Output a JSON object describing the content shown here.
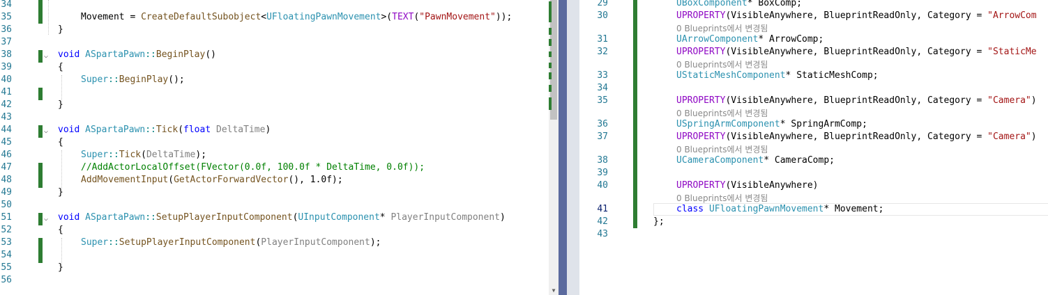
{
  "left_editor": {
    "lines": [
      {
        "n": "34"
      },
      {
        "n": "35",
        "tokens": [
          [
            "Movement = ",
            ""
          ],
          [
            "CreateDefaultSubobject",
            "fn"
          ],
          [
            "<",
            ""
          ],
          [
            "UFloatingPawnMovement",
            "ty"
          ],
          [
            ">(",
            ""
          ],
          [
            "TEXT",
            "mc"
          ],
          [
            "(",
            ""
          ],
          [
            "\"PawnMovement\"",
            "st"
          ],
          [
            "));",
            ""
          ]
        ]
      },
      {
        "n": "36",
        "tokens": [
          [
            "}",
            ""
          ]
        ]
      },
      {
        "n": "37"
      },
      {
        "n": "38",
        "tokens": [
          [
            "void",
            "kw"
          ],
          [
            " ",
            ""
          ],
          [
            "ASpartaPawn",
            "ty"
          ],
          [
            "::",
            "op"
          ],
          [
            "BeginPlay",
            "fn"
          ],
          [
            "()",
            ""
          ]
        ]
      },
      {
        "n": "39",
        "tokens": [
          [
            "{",
            ""
          ]
        ]
      },
      {
        "n": "40",
        "tokens": [
          [
            "Super",
            "ty"
          ],
          [
            "::",
            "op"
          ],
          [
            "BeginPlay",
            "fn"
          ],
          [
            "();",
            ""
          ]
        ]
      },
      {
        "n": "41"
      },
      {
        "n": "42",
        "tokens": [
          [
            "}",
            ""
          ]
        ]
      },
      {
        "n": "43"
      },
      {
        "n": "44",
        "tokens": [
          [
            "void",
            "kw"
          ],
          [
            " ",
            ""
          ],
          [
            "ASpartaPawn",
            "ty"
          ],
          [
            "::",
            "op"
          ],
          [
            "Tick",
            "fn"
          ],
          [
            "(",
            ""
          ],
          [
            "float",
            "kw"
          ],
          [
            " ",
            ""
          ],
          [
            "DeltaTime",
            "pm"
          ],
          [
            ")",
            ""
          ]
        ]
      },
      {
        "n": "45",
        "tokens": [
          [
            "{",
            ""
          ]
        ]
      },
      {
        "n": "46",
        "tokens": [
          [
            "Super",
            "ty"
          ],
          [
            "::",
            "op"
          ],
          [
            "Tick",
            "fn"
          ],
          [
            "(",
            ""
          ],
          [
            "DeltaTime",
            "pm"
          ],
          [
            ");",
            ""
          ]
        ]
      },
      {
        "n": "47",
        "tokens": [
          [
            "//AddActorLocalOffset(FVector(0.0f, 100.0f * DeltaTime, 0.0f));",
            "cm"
          ]
        ]
      },
      {
        "n": "48",
        "tokens": [
          [
            "AddMovementInput",
            "fn"
          ],
          [
            "(",
            ""
          ],
          [
            "GetActorForwardVector",
            "fn"
          ],
          [
            "(), 1.0f);",
            ""
          ]
        ]
      },
      {
        "n": "49",
        "tokens": [
          [
            "}",
            ""
          ]
        ]
      },
      {
        "n": "50"
      },
      {
        "n": "51",
        "tokens": [
          [
            "void",
            "kw"
          ],
          [
            " ",
            ""
          ],
          [
            "ASpartaPawn",
            "ty"
          ],
          [
            "::",
            "op"
          ],
          [
            "SetupPlayerInputComponent",
            "fn"
          ],
          [
            "(",
            ""
          ],
          [
            "UInputComponent",
            "ty"
          ],
          [
            "* ",
            ""
          ],
          [
            "PlayerInputComponent",
            "pm"
          ],
          [
            ")",
            ""
          ]
        ]
      },
      {
        "n": "52",
        "tokens": [
          [
            "{",
            ""
          ]
        ]
      },
      {
        "n": "53",
        "tokens": [
          [
            "Super",
            "ty"
          ],
          [
            "::",
            "op"
          ],
          [
            "SetupPlayerInputComponent",
            "fn"
          ],
          [
            "(",
            ""
          ],
          [
            "PlayerInputComponent",
            "pm"
          ],
          [
            ");",
            ""
          ]
        ]
      },
      {
        "n": "54"
      },
      {
        "n": "55",
        "tokens": [
          [
            "}",
            ""
          ]
        ]
      },
      {
        "n": "56"
      }
    ]
  },
  "right_editor": {
    "lines": [
      {
        "n": "29",
        "tokens": [
          [
            "UBoxComponent",
            "ty"
          ],
          [
            "* BoxComp;",
            ""
          ]
        ]
      },
      {
        "n": "30",
        "tokens": [
          [
            "UPROPERTY",
            "mc"
          ],
          [
            "(VisibleAnywhere, BlueprintReadOnly, Category = ",
            ""
          ],
          [
            "\"ArrowCom",
            "st"
          ]
        ]
      },
      {
        "hint": "0 Blueprints에서 변경됨"
      },
      {
        "n": "31",
        "tokens": [
          [
            "UArrowComponent",
            "ty"
          ],
          [
            "* ArrowComp;",
            ""
          ]
        ]
      },
      {
        "n": "32",
        "tokens": [
          [
            "UPROPERTY",
            "mc"
          ],
          [
            "(VisibleAnywhere, BlueprintReadOnly, Category = ",
            ""
          ],
          [
            "\"StaticMe",
            "st"
          ]
        ]
      },
      {
        "hint": "0 Blueprints에서 변경됨"
      },
      {
        "n": "33",
        "tokens": [
          [
            "UStaticMeshComponent",
            "ty"
          ],
          [
            "* StaticMeshComp;",
            ""
          ]
        ]
      },
      {
        "n": "34"
      },
      {
        "n": "35",
        "tokens": [
          [
            "UPROPERTY",
            "mc"
          ],
          [
            "(VisibleAnywhere, BlueprintReadOnly, Category = ",
            ""
          ],
          [
            "\"Camera\"",
            "st"
          ],
          [
            ")",
            ""
          ]
        ]
      },
      {
        "hint": "0 Blueprints에서 변경됨"
      },
      {
        "n": "36",
        "tokens": [
          [
            "USpringArmComponent",
            "ty"
          ],
          [
            "* SpringArmComp;",
            ""
          ]
        ]
      },
      {
        "n": "37",
        "tokens": [
          [
            "UPROPERTY",
            "mc"
          ],
          [
            "(VisibleAnywhere, BlueprintReadOnly, Category = ",
            ""
          ],
          [
            "\"Camera\"",
            "st"
          ],
          [
            ")",
            ""
          ]
        ]
      },
      {
        "hint": "0 Blueprints에서 변경됨"
      },
      {
        "n": "38",
        "tokens": [
          [
            "UCameraComponent",
            "ty"
          ],
          [
            "* CameraComp;",
            ""
          ]
        ]
      },
      {
        "n": "39"
      },
      {
        "n": "40",
        "tokens": [
          [
            "UPROPERTY",
            "mc"
          ],
          [
            "(VisibleAnywhere)",
            ""
          ]
        ]
      },
      {
        "hint": "0 Blueprints에서 변경됨"
      },
      {
        "n": "41",
        "current": true,
        "tokens": [
          [
            "class",
            "kw"
          ],
          [
            " ",
            ""
          ],
          [
            "UFloatingPawnMovement",
            "ty"
          ],
          [
            "* Movement;",
            ""
          ]
        ]
      },
      {
        "n": "42",
        "tokens": [
          [
            "};",
            ""
          ]
        ]
      },
      {
        "n": "43"
      }
    ]
  },
  "colors": {
    "change_marker": "#2e7d32",
    "splitter": "#5b6a9e",
    "line_number": "#237893"
  }
}
